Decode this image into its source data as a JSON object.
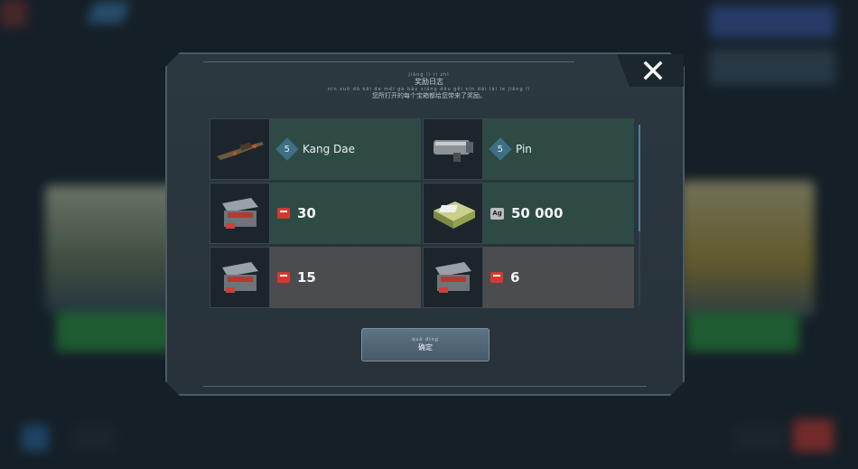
{
  "dialog": {
    "title_pinyin": "jiǎng lì rì zhì",
    "title": "奖励日志",
    "subtitle_pinyin": "nín suǒ dǎ kāi de měi gè bǎo xiāng dōu gěi nín dài lái le jiǎng lì",
    "subtitle": "您所打开的每个宝箱都给您带来了奖励。",
    "close_symbol": "✕",
    "confirm_pinyin": "què dìng",
    "confirm_label": "确定"
  },
  "rewards": [
    {
      "type": "weapon",
      "level": "5",
      "label": "Kang Dae",
      "style": "green",
      "icon": "rifle-icon"
    },
    {
      "type": "weapon",
      "level": "5",
      "label": "Pin",
      "style": "green",
      "icon": "minigun-icon"
    },
    {
      "type": "currency",
      "currency_icon": "coupon-icon",
      "label": "30",
      "style": "green",
      "icon": "chest-icon"
    },
    {
      "type": "currency",
      "currency_icon": "ag",
      "currency_label": "Ag",
      "label": "50 000",
      "style": "green",
      "icon": "silver-crate-icon"
    },
    {
      "type": "currency",
      "currency_icon": "coupon-icon",
      "label": "15",
      "style": "grey",
      "icon": "chest-icon"
    },
    {
      "type": "currency",
      "currency_icon": "coupon-icon",
      "label": "6",
      "style": "grey",
      "icon": "chest-icon"
    }
  ],
  "colors": {
    "green_cell": "#2e4a45",
    "grey_cell": "#4a4c4d",
    "accent_blue": "#4d7fa5"
  }
}
